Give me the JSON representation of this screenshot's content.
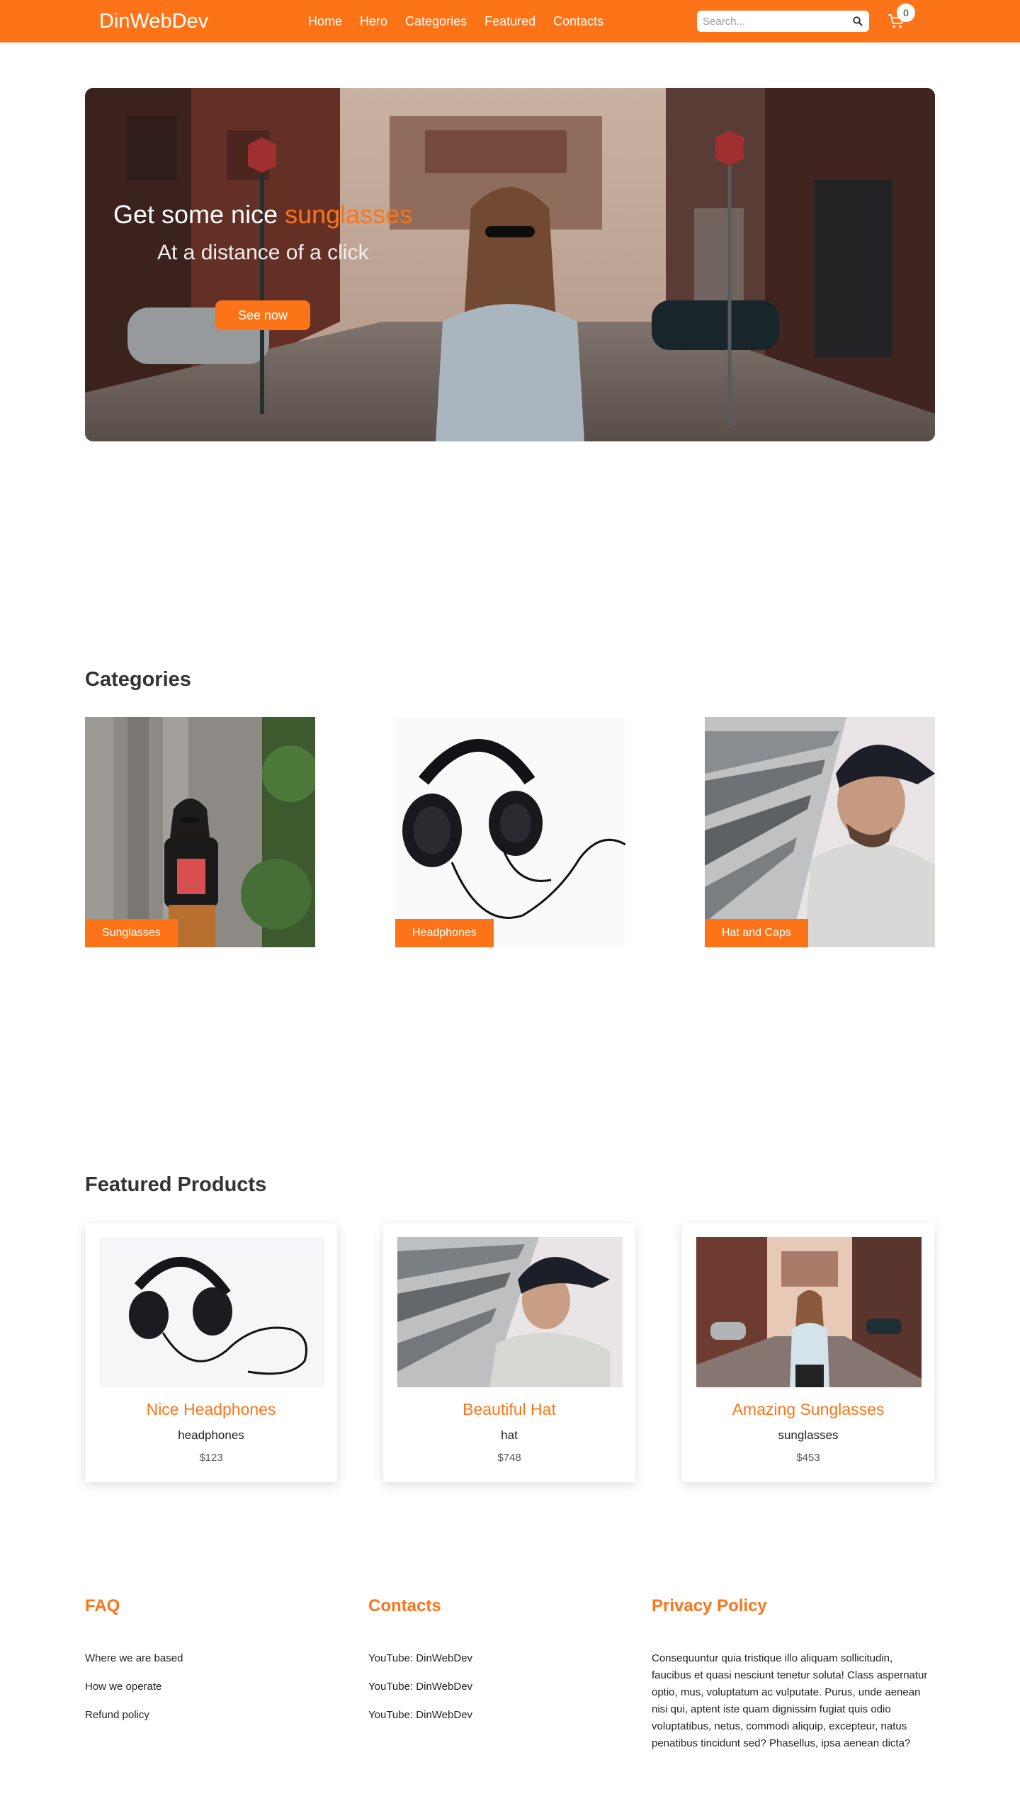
{
  "nav": {
    "brand": "DinWebDev",
    "links": [
      "Home",
      "Hero",
      "Categories",
      "Featured",
      "Contacts"
    ],
    "search_placeholder": "Search...",
    "cart_count": "0"
  },
  "hero": {
    "title_prefix": "Get some nice ",
    "title_accent": "sunglasses",
    "subtitle": "At a distance of a click",
    "button": "See now"
  },
  "categories": {
    "title": "Categories",
    "items": [
      {
        "label": "Sunglasses"
      },
      {
        "label": "Headphones"
      },
      {
        "label": "Hat and Caps"
      }
    ]
  },
  "featured": {
    "title": "Featured Products",
    "products": [
      {
        "name": "Nice Headphones",
        "category": "headphones",
        "price": "$123"
      },
      {
        "name": "Beautiful Hat",
        "category": "hat",
        "price": "$748"
      },
      {
        "name": "Amazing Sunglasses",
        "category": "sunglasses",
        "price": "$453"
      }
    ]
  },
  "footer": {
    "faq": {
      "title": "FAQ",
      "items": [
        "Where we are based",
        "How we operate",
        "Refund policy"
      ]
    },
    "contacts": {
      "title": "Contacts",
      "items": [
        "YouTube: DinWebDev",
        "YouTube: DinWebDev",
        "YouTube: DinWebDev"
      ]
    },
    "privacy": {
      "title": "Privacy Policy",
      "text": "Consequuntur quia tristique illo aliquam sollicitudin, faucibus et quasi nesciunt tenetur soluta! Class aspernatur optio, mus, voluptatum ac vulputate. Purus, unde aenean nisi qui, aptent iste quam dignissim fugiat quis odio voluptatibus, netus, commodi aliquip, excepteur, natus penatibus tincidunt sed? Phasellus, ipsa aenean dicta?"
    }
  },
  "colors": {
    "accent": "#fd7418"
  }
}
